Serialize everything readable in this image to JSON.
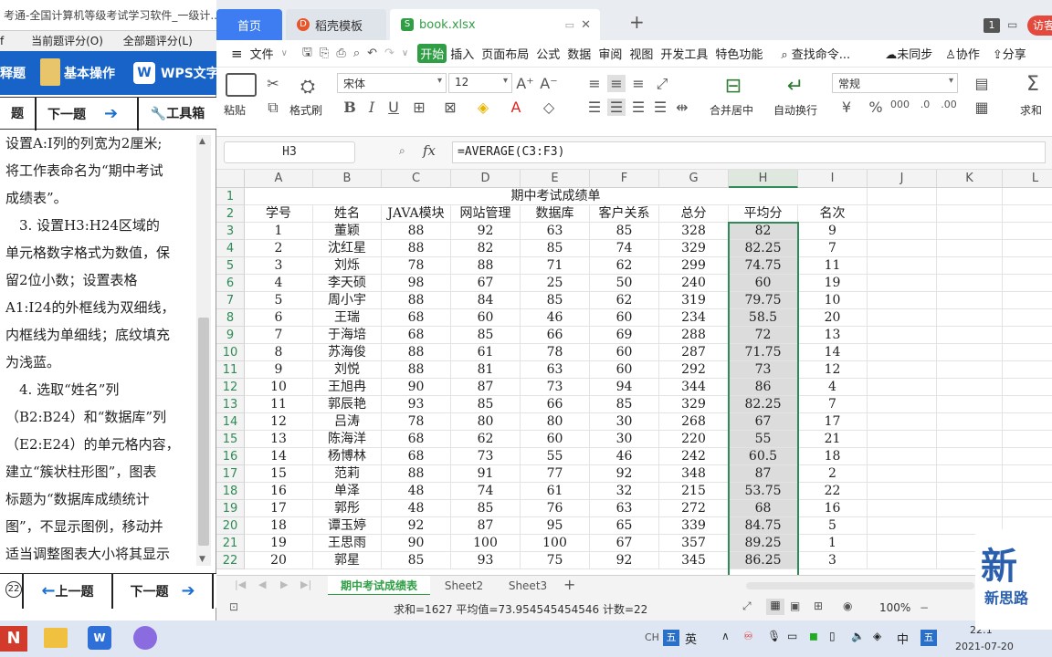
{
  "tabs": {
    "home": "首页",
    "template": "稻壳模板",
    "file": "book.xlsx",
    "new": "+",
    "badge": "1",
    "visitor": "访客"
  },
  "menu": {
    "file": "文件",
    "items": [
      "开始",
      "插入",
      "页面布局",
      "公式",
      "数据",
      "审阅",
      "视图",
      "开发工具",
      "特色功能"
    ],
    "search": "查找命令...",
    "sync": "未同步",
    "collab": "协作",
    "share": "分享"
  },
  "ribbon": {
    "paste": "粘贴",
    "format_painter": "格式刷",
    "font": "宋体",
    "size": "12",
    "merge": "合并居中",
    "wrap": "自动换行",
    "number_format": "常规",
    "sum": "求和"
  },
  "formula": {
    "namebox": "H3",
    "fx": "fx",
    "value": "=AVERAGE(C3:F3)"
  },
  "grid": {
    "cols": [
      "A",
      "B",
      "C",
      "D",
      "E",
      "F",
      "G",
      "H",
      "I",
      "J",
      "K",
      "L"
    ],
    "rows": [
      "1",
      "2",
      "3",
      "4",
      "5",
      "6",
      "7",
      "8",
      "9",
      "10",
      "11",
      "12",
      "13",
      "14",
      "15",
      "16",
      "17",
      "18",
      "19",
      "20",
      "21",
      "22"
    ],
    "title": "期中考试成绩单",
    "headers": [
      "学号",
      "姓名",
      "JAVA模块",
      "网站管理",
      "数据库",
      "客户关系",
      "总分",
      "平均分",
      "名次"
    ],
    "data": [
      [
        "1",
        "董颖",
        "88",
        "92",
        "63",
        "85",
        "328",
        "82",
        "9"
      ],
      [
        "2",
        "沈红星",
        "88",
        "82",
        "85",
        "74",
        "329",
        "82.25",
        "7"
      ],
      [
        "3",
        "刘烁",
        "78",
        "88",
        "71",
        "62",
        "299",
        "74.75",
        "11"
      ],
      [
        "4",
        "李天硕",
        "98",
        "67",
        "25",
        "50",
        "240",
        "60",
        "19"
      ],
      [
        "5",
        "周小宇",
        "88",
        "84",
        "85",
        "62",
        "319",
        "79.75",
        "10"
      ],
      [
        "6",
        "王瑞",
        "68",
        "60",
        "46",
        "60",
        "234",
        "58.5",
        "20"
      ],
      [
        "7",
        "于海培",
        "68",
        "85",
        "66",
        "69",
        "288",
        "72",
        "13"
      ],
      [
        "8",
        "苏海俊",
        "88",
        "61",
        "78",
        "60",
        "287",
        "71.75",
        "14"
      ],
      [
        "9",
        "刘悦",
        "88",
        "81",
        "63",
        "60",
        "292",
        "73",
        "12"
      ],
      [
        "10",
        "王旭冉",
        "90",
        "87",
        "73",
        "94",
        "344",
        "86",
        "4"
      ],
      [
        "11",
        "郭辰艳",
        "93",
        "85",
        "66",
        "85",
        "329",
        "82.25",
        "7"
      ],
      [
        "12",
        "吕涛",
        "78",
        "80",
        "80",
        "30",
        "268",
        "67",
        "17"
      ],
      [
        "13",
        "陈海洋",
        "68",
        "62",
        "60",
        "30",
        "220",
        "55",
        "21"
      ],
      [
        "14",
        "杨博林",
        "68",
        "73",
        "55",
        "46",
        "242",
        "60.5",
        "18"
      ],
      [
        "15",
        "范莉",
        "88",
        "91",
        "77",
        "92",
        "348",
        "87",
        "2"
      ],
      [
        "16",
        "单泽",
        "48",
        "74",
        "61",
        "32",
        "215",
        "53.75",
        "22"
      ],
      [
        "17",
        "郭彤",
        "48",
        "85",
        "76",
        "63",
        "272",
        "68",
        "16"
      ],
      [
        "18",
        "谭玉婷",
        "92",
        "87",
        "95",
        "65",
        "339",
        "84.75",
        "5"
      ],
      [
        "19",
        "王思雨",
        "90",
        "100",
        "100",
        "67",
        "357",
        "89.25",
        "1"
      ],
      [
        "20",
        "郭星",
        "85",
        "93",
        "75",
        "92",
        "345",
        "86.25",
        "3"
      ]
    ]
  },
  "sheets": [
    "期中考试成绩表",
    "Sheet2",
    "Sheet3"
  ],
  "status": {
    "stats": "求和=1627  平均值=73.954545454546  计数=22",
    "zoom": "100%"
  },
  "left": {
    "title": "考通-全国计算机等级考试学习软件_一级计...",
    "menu": [
      "f",
      "当前题评分(O)",
      "全部题评分(L)"
    ],
    "blue": [
      "释题",
      "基本操作",
      "WPS文字"
    ],
    "nav": [
      "题",
      "下一题",
      "工具箱"
    ],
    "lines": [
      "设置A:I列的列宽为2厘米;",
      "将工作表命名为“期中考试",
      "成绩表”。",
      "　3. 设置H3:H24区域的",
      "单元格数字格式为数值，保",
      "留2位小数；设置表格",
      "A1:I24的外框线为双细线，",
      "内框线为单细线；底纹填充",
      "为浅蓝。",
      "　4. 选取“姓名”列",
      "（B2:B24）和“数据库”列",
      "（E2:E24）的单元格内容，",
      "建立“簇状柱形图”，图表",
      "标题为“数据库成绩统计",
      "图”，不显示图例，移动并",
      "适当调整图表大小将其显示"
    ],
    "bottom": [
      "22",
      "上一题",
      "下一题"
    ]
  },
  "taskbar": {
    "ime1": "CH",
    "ime2": "五",
    "ime3": "英",
    "lang": "中",
    "ime4": "五",
    "time": "22:1",
    "date": "2021-07-20",
    "watermark": "新思路"
  },
  "colors": {
    "accent": "#2f9e44",
    "blue": "#3d7df1",
    "selection": "#2e8b57"
  }
}
